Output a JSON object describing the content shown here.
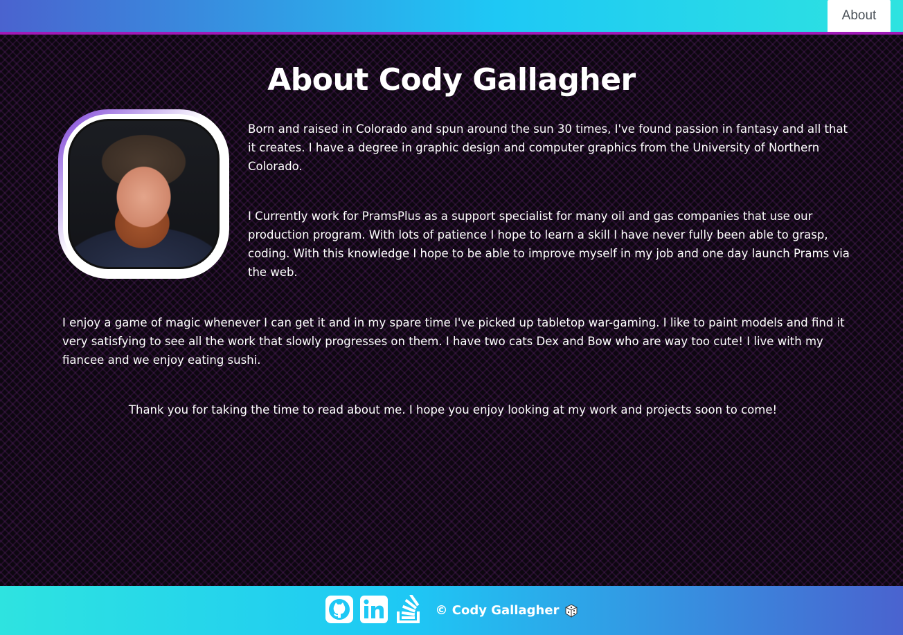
{
  "nav": {
    "about_label": "About"
  },
  "page": {
    "title": "About Cody Gallagher"
  },
  "content": {
    "paragraph_1": "Born and raised in Colorado and spun around the sun 30 times, I've found passion in fantasy and all that it creates. I have a degree in graphic design and computer graphics from the University of Northern Colorado.",
    "paragraph_2": "I Currently work for PramsPlus as a support specialist for many oil and gas companies that use our production program. With lots of patience I hope to learn a skill I have never fully been able to grasp, coding. With this knowledge I hope to be able to improve myself in my job and one day launch Prams via the web.",
    "paragraph_3": "I enjoy a game of magic whenever I can get it and in my spare time I've picked up tabletop war-gaming. I like to paint models and find it very satisfying to see all the work that slowly progresses on them. I have two cats Dex and Bow who are way too cute! I live with my fiancee and we enjoy eating sushi.",
    "paragraph_4": "Thank you for taking the time to read about me. I hope you enjoy looking at my work and projects soon to come!"
  },
  "footer": {
    "copyright": "© Cody Gallagher",
    "icons": [
      "github-icon",
      "linkedin-icon",
      "stackoverflow-icon",
      "dice-icon"
    ]
  },
  "colors": {
    "accent_border": "#a11ab7",
    "gradient_start": "#4a63cf",
    "gradient_mid": "#1ec8f5",
    "gradient_end": "#2ee3e0",
    "background": "#0d0710"
  }
}
